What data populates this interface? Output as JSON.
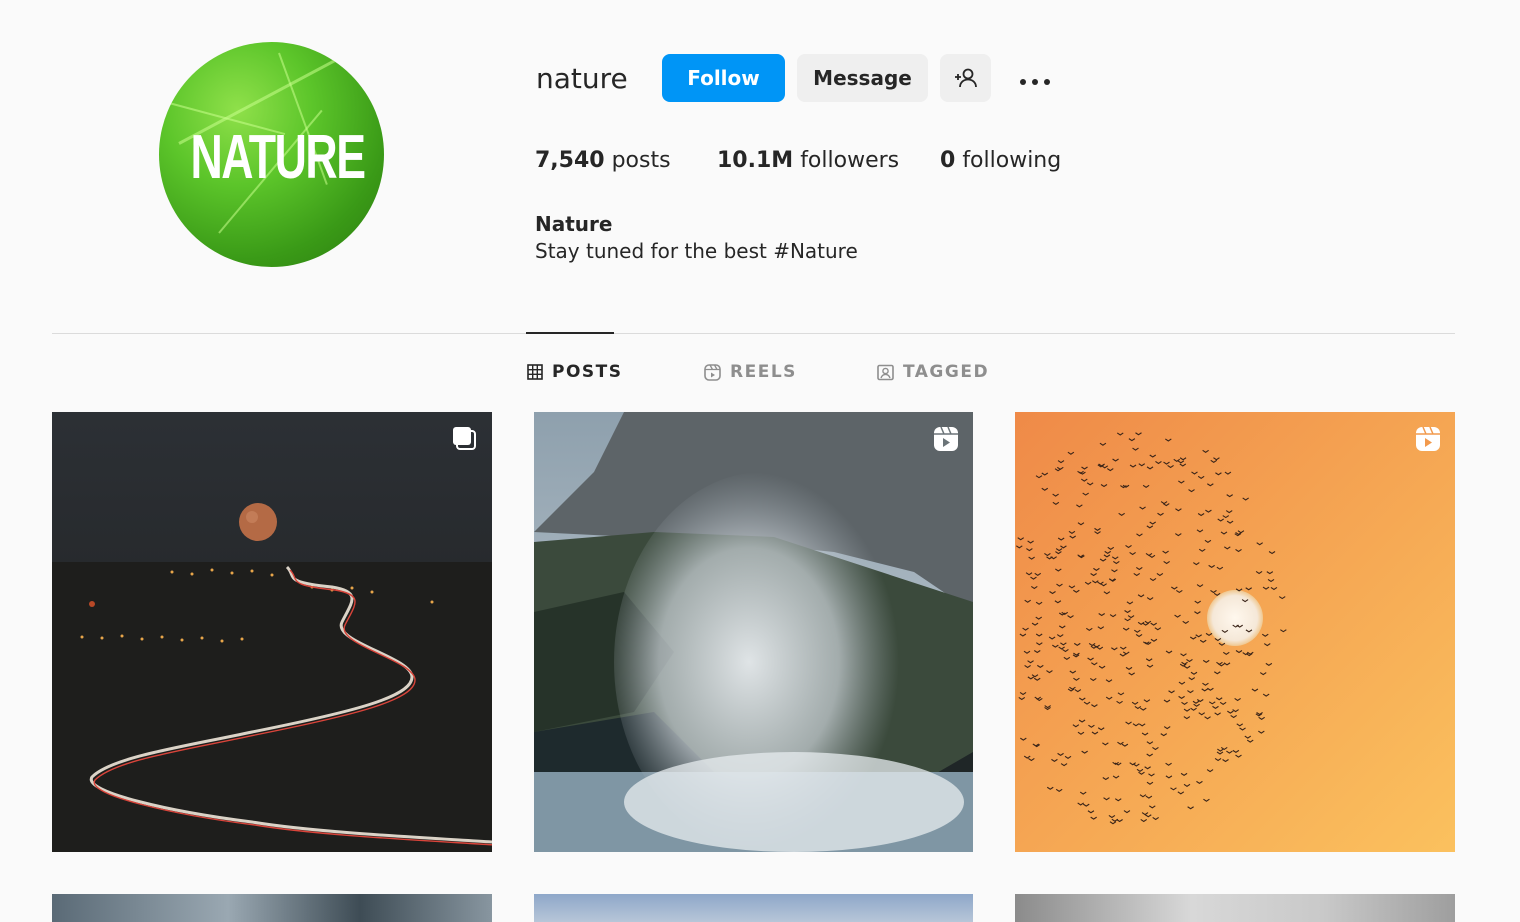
{
  "profile": {
    "username": "nature",
    "avatar_text": "NATURE",
    "full_name": "Nature",
    "bio": "Stay tuned for the best #Nature"
  },
  "actions": {
    "follow_label": "Follow",
    "message_label": "Message",
    "add_user_icon": "add-user-icon",
    "more_icon": "more-options-icon"
  },
  "stats": {
    "posts_count": "7,540",
    "posts_label": "posts",
    "followers_count": "10.1M",
    "followers_label": "followers",
    "following_count": "0",
    "following_label": "following"
  },
  "tabs": [
    {
      "label": "POSTS",
      "icon": "grid-icon",
      "active": true
    },
    {
      "label": "REELS",
      "icon": "reels-icon",
      "active": false
    },
    {
      "label": "TAGGED",
      "icon": "tagged-icon",
      "active": false
    }
  ],
  "posts": [
    {
      "type": "carousel",
      "badge_icon": "carousel-icon",
      "scene": "night road under full moon"
    },
    {
      "type": "reel",
      "badge_icon": "reel-icon",
      "scene": "wind-blown waterfall over sea cliff"
    },
    {
      "type": "reel",
      "badge_icon": "reel-icon",
      "scene": "flock of birds with moon on orange sky"
    },
    {
      "type": "carousel",
      "badge_icon": "carousel-icon"
    },
    {
      "type": "reel",
      "badge_icon": "reel-icon"
    },
    {
      "type": "reel",
      "badge_icon": "reel-icon"
    }
  ],
  "colors": {
    "accent": "#0095f6",
    "background": "#fafafa",
    "text": "#262626",
    "muted": "#8e8e8e"
  }
}
